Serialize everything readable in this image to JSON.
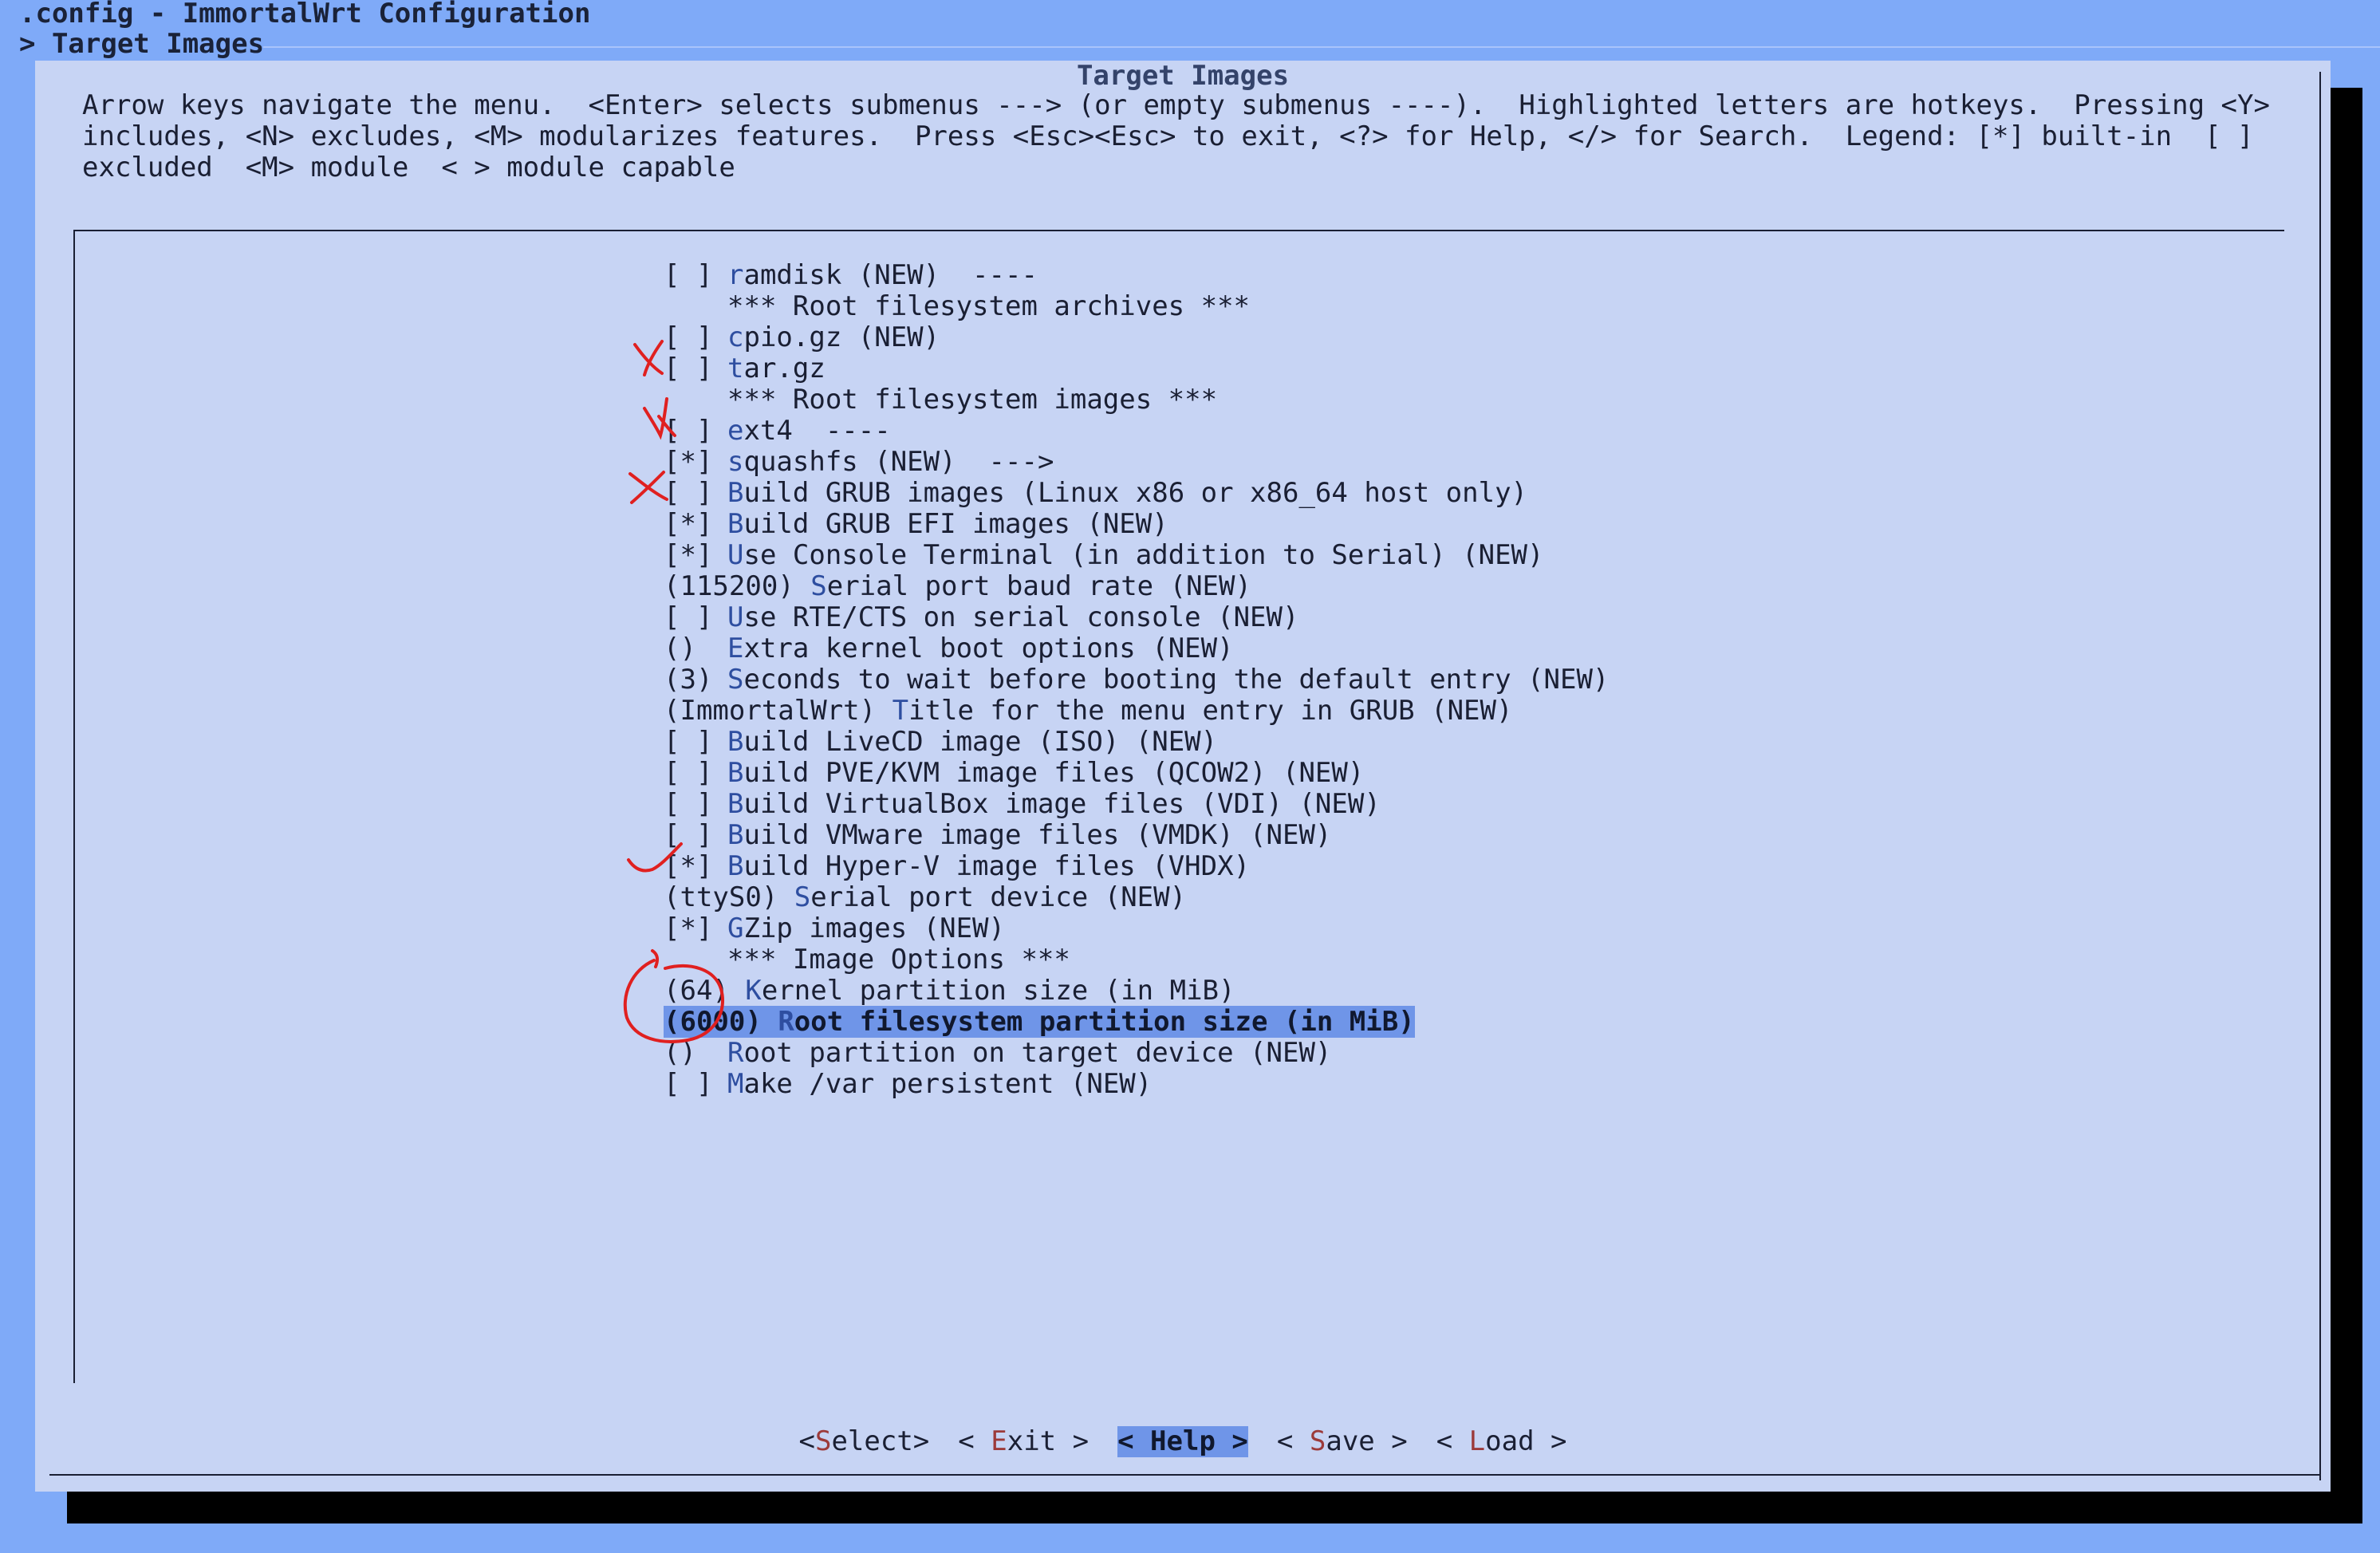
{
  "window": {
    "title": ".config - ImmortalWrt Configuration",
    "breadcrumb": "> Target Images"
  },
  "dialog": {
    "title": "Target Images",
    "help_lines": [
      "Arrow keys navigate the menu.  <Enter> selects submenus ---> (or empty submenus ----).  Highlighted letters are hotkeys.  Pressing <Y>",
      "includes, <N> excludes, <M> modularizes features.  Press <Esc><Esc> to exit, <?> for Help, </> for Search.  Legend: [*] built-in  [ ]",
      "excluded  <M> module  < > module capable"
    ]
  },
  "menu": {
    "items": [
      {
        "prefix": "[ ]",
        "hotkey": "r",
        "rest": "amdisk (NEW)  ----"
      },
      {
        "prefix": "",
        "hotkey": "",
        "rest": "*** Root filesystem archives ***"
      },
      {
        "prefix": "[ ]",
        "hotkey": "c",
        "rest": "pio.gz (NEW)"
      },
      {
        "prefix": "[ ]",
        "hotkey": "t",
        "rest": "ar.gz"
      },
      {
        "prefix": "",
        "hotkey": "",
        "rest": "*** Root filesystem images ***"
      },
      {
        "prefix": "[ ]",
        "hotkey": "e",
        "rest": "xt4  ----"
      },
      {
        "prefix": "[*]",
        "hotkey": "s",
        "rest": "quashfs (NEW)  --->"
      },
      {
        "prefix": "[ ]",
        "hotkey": "B",
        "rest": "uild GRUB images (Linux x86 or x86_64 host only)"
      },
      {
        "prefix": "[*]",
        "hotkey": "B",
        "rest": "uild GRUB EFI images (NEW)"
      },
      {
        "prefix": "[*]",
        "hotkey": "U",
        "rest": "se Console Terminal (in addition to Serial) (NEW)"
      },
      {
        "prefix": "(115200)",
        "hotkey": "S",
        "rest": "erial port baud rate (NEW)"
      },
      {
        "prefix": "[ ]",
        "hotkey": "U",
        "rest": "se RTE/CTS on serial console (NEW)"
      },
      {
        "prefix": "()",
        "hotkey": "E",
        "rest": "xtra kernel boot options (NEW)"
      },
      {
        "prefix": "(3)",
        "hotkey": "S",
        "rest": "econds to wait before booting the default entry (NEW)"
      },
      {
        "prefix": "(ImmortalWrt)",
        "hotkey": "T",
        "rest": "itle for the menu entry in GRUB (NEW)"
      },
      {
        "prefix": "[ ]",
        "hotkey": "B",
        "rest": "uild LiveCD image (ISO) (NEW)"
      },
      {
        "prefix": "[ ]",
        "hotkey": "B",
        "rest": "uild PVE/KVM image files (QCOW2) (NEW)"
      },
      {
        "prefix": "[ ]",
        "hotkey": "B",
        "rest": "uild VirtualBox image files (VDI) (NEW)"
      },
      {
        "prefix": "[ ]",
        "hotkey": "B",
        "rest": "uild VMware image files (VMDK) (NEW)"
      },
      {
        "prefix": "[*]",
        "hotkey": "B",
        "rest": "uild Hyper-V image files (VHDX)"
      },
      {
        "prefix": "(ttyS0)",
        "hotkey": "S",
        "rest": "erial port device (NEW)"
      },
      {
        "prefix": "[*]",
        "hotkey": "G",
        "rest": "Zip images (NEW)"
      },
      {
        "prefix": "",
        "hotkey": "",
        "rest": "*** Image Options ***"
      },
      {
        "prefix": "(64)",
        "hotkey": "K",
        "rest": "ernel partition size (in MiB)"
      },
      {
        "prefix": "(6000)",
        "hotkey": "R",
        "rest": "oot filesystem partition size (in MiB)",
        "selected": true
      },
      {
        "prefix": "()",
        "hotkey": "R",
        "rest": "oot partition on target device (NEW)"
      },
      {
        "prefix": "[ ]",
        "hotkey": "M",
        "rest": "ake /var persistent (NEW)"
      }
    ]
  },
  "buttons": [
    {
      "left": "<",
      "hotkey": "S",
      "rest": "elect",
      "right": ">",
      "active": false
    },
    {
      "left": "< ",
      "hotkey": "E",
      "rest": "xit",
      "right": " >",
      "active": false
    },
    {
      "left": "< ",
      "hotkey": "H",
      "rest": "elp",
      "right": " >",
      "active": true
    },
    {
      "left": "< ",
      "hotkey": "S",
      "rest": "ave",
      "right": " >",
      "active": false
    },
    {
      "left": "< ",
      "hotkey": "L",
      "rest": "oad",
      "right": " >",
      "active": false
    }
  ],
  "colors": {
    "screen_bg": "#7faaf8",
    "dialog_bg": "#c7d4f4",
    "selection": "#6f95e8",
    "annotation": "#e02020"
  }
}
